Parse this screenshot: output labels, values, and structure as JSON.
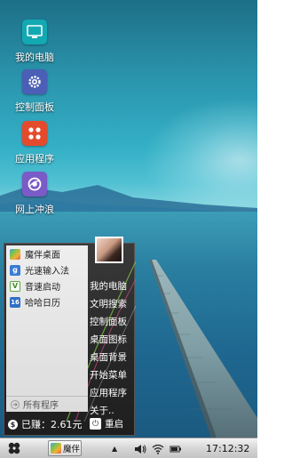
{
  "desktop": {
    "icons": [
      {
        "label": "我的电脑",
        "icon": "monitor-icon",
        "color": "#12a9b3"
      },
      {
        "label": "控制面板",
        "icon": "gear-icon",
        "color": "#4a5fb5"
      },
      {
        "label": "应用程序",
        "icon": "apps-grid-icon",
        "color": "#e44b2d"
      },
      {
        "label": "网上冲浪",
        "icon": "browser-icon",
        "color": "#7a5bc7"
      }
    ]
  },
  "start_menu": {
    "apps": [
      {
        "label": "魔伴桌面",
        "icon": "mobanzhuomian-icon"
      },
      {
        "label": "光速输入法",
        "icon": "input-method-icon"
      },
      {
        "label": "音速启动",
        "icon": "launcher-icon"
      },
      {
        "label": "哈哈日历",
        "icon": "calendar-icon"
      }
    ],
    "all_programs": "所有程序",
    "right_items": [
      "我的电脑",
      "文明搜索",
      "控制面板",
      "桌面图标",
      "桌面背景",
      "开始菜单",
      "应用程序",
      "关于.."
    ],
    "balance": "已赚：2.61元",
    "restart": "重启"
  },
  "taskbar": {
    "task_label": "魔伴",
    "clock": "17:12:32"
  }
}
